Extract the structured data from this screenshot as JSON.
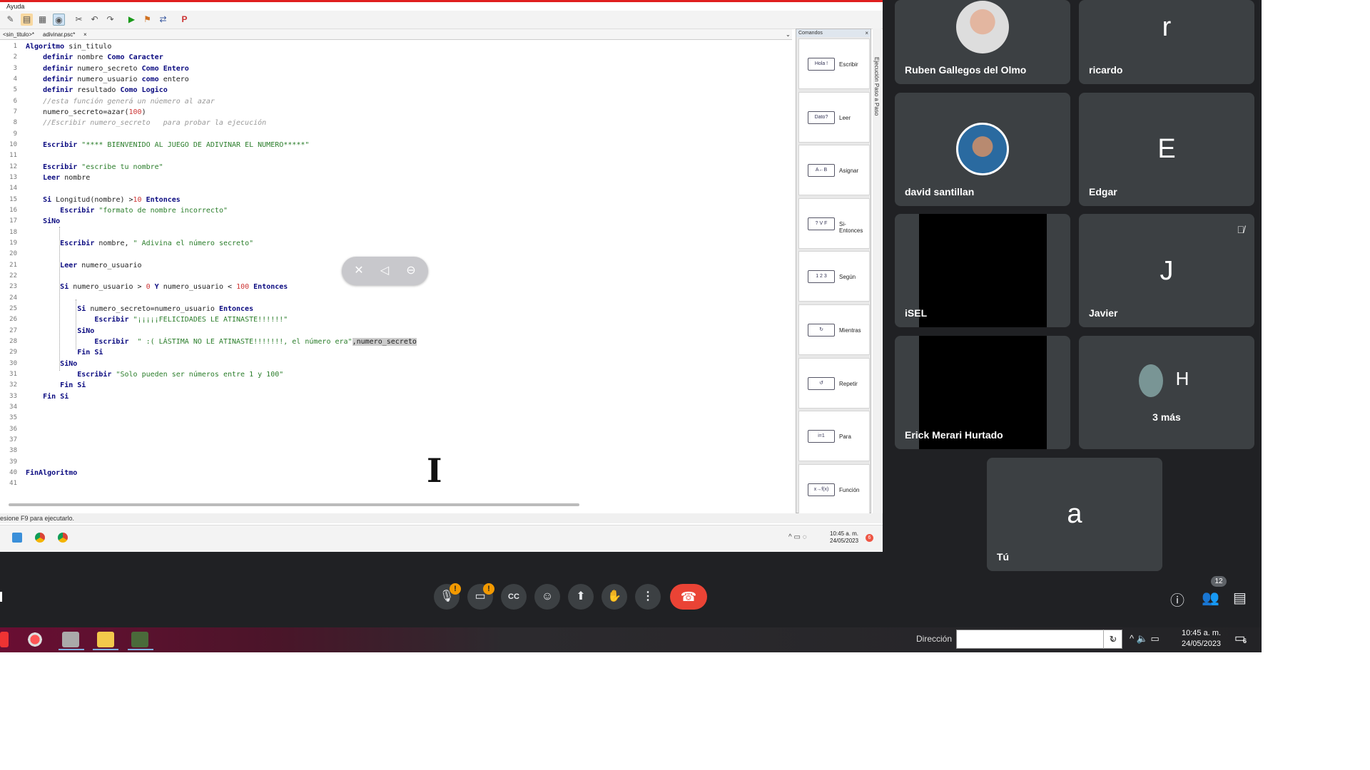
{
  "editor_app": {
    "menu": "Ayuda",
    "tabs": [
      "<sin_titulo>*",
      "adivinar.psc*"
    ],
    "tab_close": "×",
    "lines": [
      {
        "n": "1",
        "t": "Algoritmo sin_titulo"
      },
      {
        "n": "2",
        "t": "    definir nombre Como Caracter"
      },
      {
        "n": "3",
        "t": "    definir numero_secreto Como Entero"
      },
      {
        "n": "4",
        "t": "    definir numero_usuario como entero"
      },
      {
        "n": "5",
        "t": "    definir resultado Como Logico"
      },
      {
        "n": "6",
        "t": "    //esta función generá un núemero al azar"
      },
      {
        "n": "7",
        "t": "    numero_secreto=azar(100)"
      },
      {
        "n": "8",
        "t": "    //Escribir numero_secreto   para probar la ejecución"
      },
      {
        "n": "9",
        "t": ""
      },
      {
        "n": "10",
        "t": "    Escribir \"**** BIENVENIDO AL JUEGO DE ADIVINAR EL NUMERO*****\""
      },
      {
        "n": "11",
        "t": ""
      },
      {
        "n": "12",
        "t": "    Escribir \"escribe tu nombre\""
      },
      {
        "n": "13",
        "t": "    Leer nombre"
      },
      {
        "n": "14",
        "t": ""
      },
      {
        "n": "15",
        "t": "    Si Longitud(nombre) >10 Entonces"
      },
      {
        "n": "16",
        "t": "        Escribir \"formato de nombre incorrecto\""
      },
      {
        "n": "17",
        "t": "    SiNo"
      },
      {
        "n": "18",
        "t": ""
      },
      {
        "n": "19",
        "t": "        Escribir nombre, \" Adivina el número secreto\""
      },
      {
        "n": "20",
        "t": ""
      },
      {
        "n": "21",
        "t": "        Leer numero_usuario"
      },
      {
        "n": "22",
        "t": ""
      },
      {
        "n": "23",
        "t": "        Si numero_usuario > 0 Y numero_usuario < 100 Entonces"
      },
      {
        "n": "24",
        "t": ""
      },
      {
        "n": "25",
        "t": "            Si numero_secreto=numero_usuario Entonces"
      },
      {
        "n": "26",
        "t": "                Escribir \"¡¡¡¡¡FELICIDADES LE ATINASTE!!!!!!\""
      },
      {
        "n": "27",
        "t": "            SiNo"
      },
      {
        "n": "28",
        "t": "                Escribir  \" :( LÁSTIMA NO LE ATINASTE!!!!!!!, el número era\",numero_secreto"
      },
      {
        "n": "29",
        "t": "            Fin Si"
      },
      {
        "n": "30",
        "t": "        SiNo"
      },
      {
        "n": "31",
        "t": "            Escribir \"Solo pueden ser números entre 1 y 100\""
      },
      {
        "n": "32",
        "t": "        Fin Si"
      },
      {
        "n": "33",
        "t": "    Fin Si"
      },
      {
        "n": "34",
        "t": ""
      },
      {
        "n": "35",
        "t": ""
      },
      {
        "n": "36",
        "t": ""
      },
      {
        "n": "37",
        "t": ""
      },
      {
        "n": "38",
        "t": ""
      },
      {
        "n": "39",
        "t": ""
      },
      {
        "n": "40",
        "t": "FinAlgoritmo"
      },
      {
        "n": "41",
        "t": ""
      }
    ],
    "commands_panel": {
      "title": "Comandos",
      "close": "×",
      "items": [
        {
          "label": "Escribir",
          "glyph": "Hola !"
        },
        {
          "label": "Leer",
          "glyph": "Dato?"
        },
        {
          "label": "Asignar",
          "glyph": "A←B"
        },
        {
          "label": "Si-Entonces",
          "glyph": "? V F"
        },
        {
          "label": "Según",
          "glyph": "1 2 3"
        },
        {
          "label": "Mientras",
          "glyph": "↻"
        },
        {
          "label": "Repetir",
          "glyph": "↺"
        },
        {
          "label": "Para",
          "glyph": "i=1"
        },
        {
          "label": "Función",
          "glyph": "x→f(x)"
        }
      ]
    },
    "side_strip": "Ejecución Paso a Paso",
    "status": "esione F9 para ejecutarlo.",
    "inner_clock": {
      "time": "10:45 a. m.",
      "date": "24/05/2023"
    },
    "inner_badge": "6"
  },
  "participants": [
    {
      "name": "Ruben Gallegos del Olmo",
      "type": "photo"
    },
    {
      "name": "ricardo",
      "initial": "r",
      "color": "#4a5d6b"
    },
    {
      "name": "david santillan",
      "type": "photo"
    },
    {
      "name": "Edgar",
      "initial": "E",
      "color": "#b34fc6"
    },
    {
      "name": "iSEL",
      "type": "video"
    },
    {
      "name": "Javier",
      "initial": "J",
      "color": "#c5381c",
      "muted": true
    },
    {
      "name": "Erick Merari Hurtado",
      "type": "video"
    },
    {
      "name": "3 más",
      "initial": "H",
      "color": "#d03a1f"
    },
    {
      "name": "Tú",
      "initial": "a",
      "color": "#8d6e63"
    }
  ],
  "meet_controls": {
    "mic_icon": "mic-icon",
    "cam_icon": "camera-icon",
    "cc_icon": "captions-icon",
    "emoji_icon": "emoji-icon",
    "present_icon": "present-icon",
    "hand_icon": "hand-icon",
    "more_icon": "more-icon",
    "hangup_icon": "hangup-icon",
    "warning": "!",
    "people_count": "12"
  },
  "taskbar": {
    "address_label": "Dirección",
    "address_value": "",
    "clock": {
      "time": "10:45 a. m.",
      "date": "24/05/2023"
    },
    "notif_count": "6"
  },
  "colors": {
    "meet_bg": "#202124",
    "tile_bg": "#3c4043",
    "hangup": "#ea4335",
    "warning": "#f29900",
    "keyword": "#0a0a80",
    "string": "#2a7d2a"
  }
}
